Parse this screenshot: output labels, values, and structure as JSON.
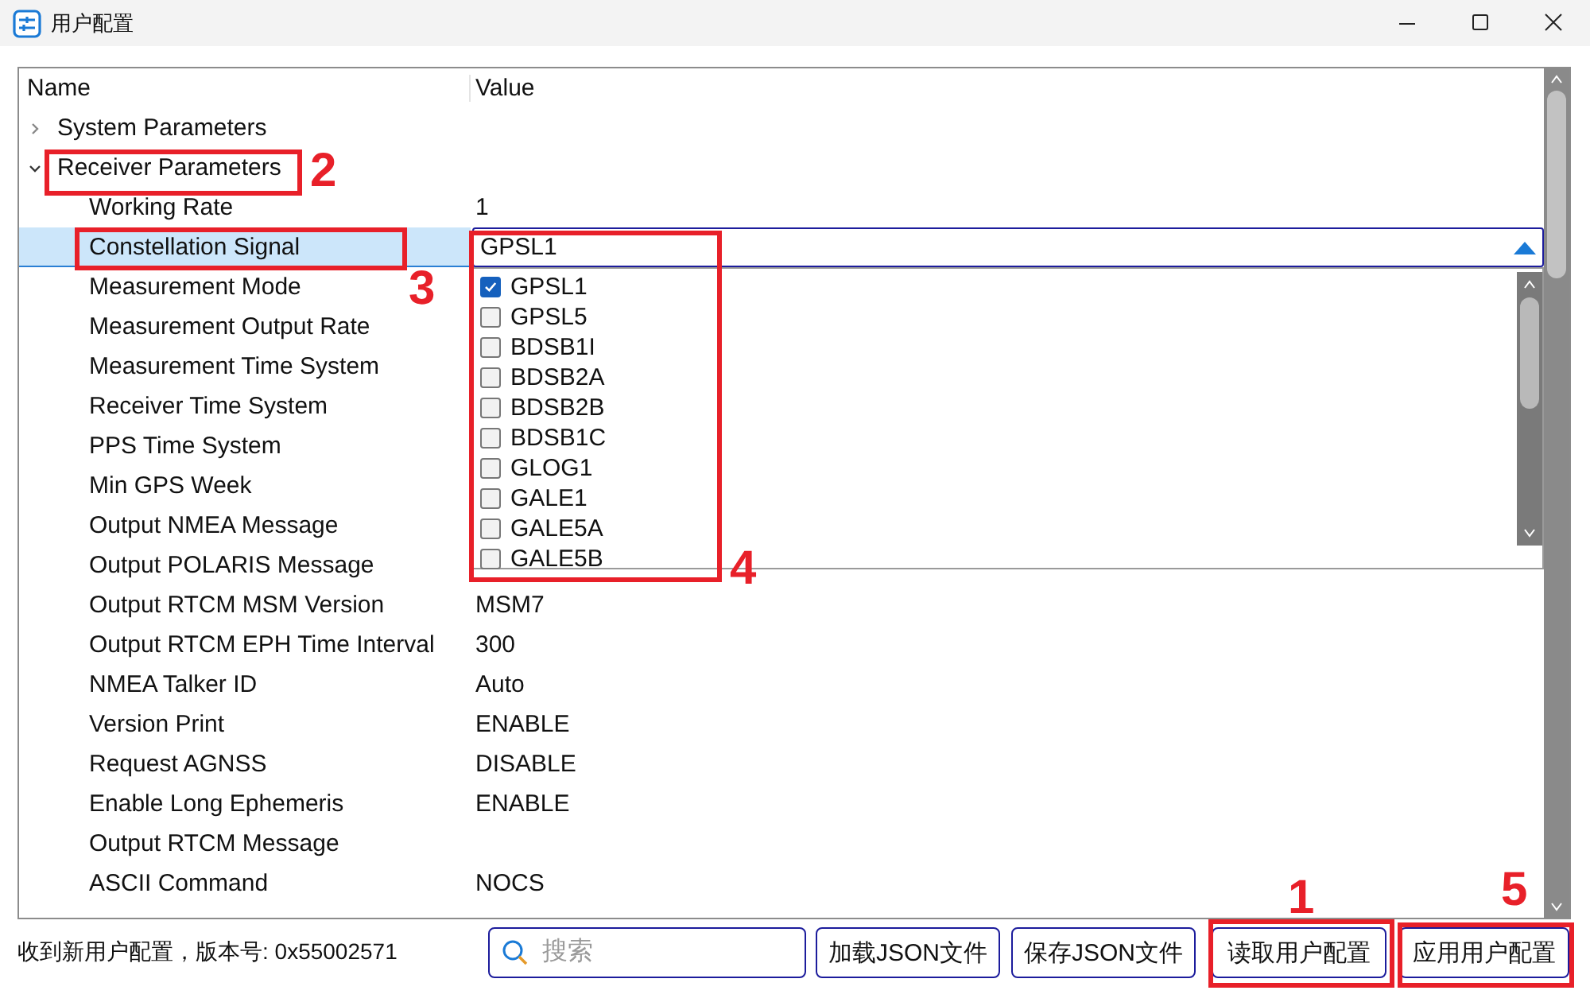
{
  "window": {
    "title": "用户配置"
  },
  "tree": {
    "columns": [
      "Name",
      "Value"
    ],
    "items": [
      {
        "name": "System Parameters",
        "expanded": false
      },
      {
        "name": "Receiver Parameters",
        "expanded": true,
        "children": [
          {
            "name": "Working Rate",
            "value": "1",
            "selected": false
          },
          {
            "name": "Constellation Signal",
            "selected": true,
            "editor": {
              "value": "GPSL1",
              "options": [
                {
                  "label": "GPSL1",
                  "checked": true
                },
                {
                  "label": "GPSL5",
                  "checked": false
                },
                {
                  "label": "BDSB1I",
                  "checked": false
                },
                {
                  "label": "BDSB2A",
                  "checked": false
                },
                {
                  "label": "BDSB2B",
                  "checked": false
                },
                {
                  "label": "BDSB1C",
                  "checked": false
                },
                {
                  "label": "GLOG1",
                  "checked": false
                },
                {
                  "label": "GALE1",
                  "checked": false
                },
                {
                  "label": "GALE5A",
                  "checked": false
                },
                {
                  "label": "GALE5B",
                  "checked": false
                }
              ]
            }
          },
          {
            "name": "Measurement Mode",
            "selected": false
          },
          {
            "name": "Measurement Output Rate",
            "selected": false
          },
          {
            "name": "Measurement Time System",
            "selected": false
          },
          {
            "name": "Receiver Time System",
            "selected": false
          },
          {
            "name": "PPS Time System",
            "selected": false
          },
          {
            "name": "Min GPS Week",
            "selected": false
          },
          {
            "name": "Output NMEA Message",
            "selected": false
          },
          {
            "name": "Output POLARIS Message",
            "selected": false
          },
          {
            "name": "Output RTCM MSM Version",
            "value": "MSM7",
            "selected": false
          },
          {
            "name": "Output RTCM EPH Time Interval",
            "value": "300",
            "selected": false
          },
          {
            "name": "NMEA Talker ID",
            "value": "Auto",
            "selected": false
          },
          {
            "name": "Version Print",
            "value": "ENABLE",
            "selected": false
          },
          {
            "name": "Request AGNSS",
            "value": "DISABLE",
            "selected": false
          },
          {
            "name": "Enable Long Ephemeris",
            "value": "ENABLE",
            "selected": false
          },
          {
            "name": "Output RTCM Message",
            "selected": false
          },
          {
            "name": "ASCII Command",
            "value": "NOCS",
            "selected": false
          }
        ]
      }
    ]
  },
  "footer": {
    "status": "收到新用户配置，版本号: 0x55002571",
    "search": {
      "placeholder": "搜索"
    },
    "buttons": [
      "加载JSON文件",
      "保存JSON文件",
      "读取用户配置",
      "应用用户配置"
    ]
  },
  "annotations": [
    {
      "label": "1"
    },
    {
      "label": "2"
    },
    {
      "label": "3"
    },
    {
      "label": "4"
    },
    {
      "label": "5"
    }
  ]
}
